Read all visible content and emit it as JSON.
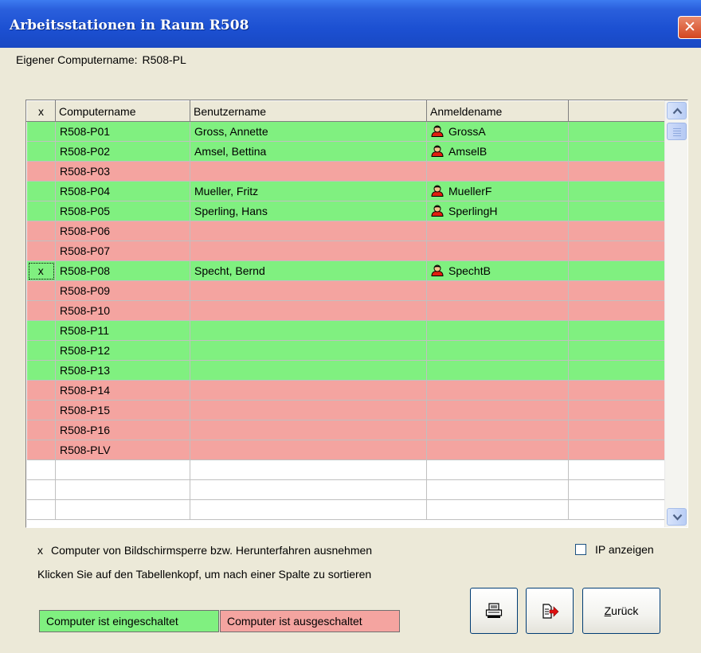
{
  "window": {
    "title": "Arbeitsstationen in Raum R508",
    "close_glyph": "✕"
  },
  "own_computer": {
    "label": "Eigener Computername:",
    "value": "R508-PL"
  },
  "table": {
    "columns": [
      "x",
      "Computername",
      "Benutzername",
      "Anmeldename",
      ""
    ],
    "rows": [
      {
        "x": "",
        "computer": "R508-P01",
        "user": "Gross, Annette",
        "login": "GrossA",
        "status": "on"
      },
      {
        "x": "",
        "computer": "R508-P02",
        "user": "Amsel, Bettina",
        "login": "AmselB",
        "status": "on"
      },
      {
        "x": "",
        "computer": "R508-P03",
        "user": "",
        "login": "",
        "status": "off"
      },
      {
        "x": "",
        "computer": "R508-P04",
        "user": "Mueller, Fritz",
        "login": "MuellerF",
        "status": "on"
      },
      {
        "x": "",
        "computer": "R508-P05",
        "user": "Sperling, Hans",
        "login": "SperlingH",
        "status": "on"
      },
      {
        "x": "",
        "computer": "R508-P06",
        "user": "",
        "login": "",
        "status": "off"
      },
      {
        "x": "",
        "computer": "R508-P07",
        "user": "",
        "login": "",
        "status": "off"
      },
      {
        "x": "x",
        "computer": "R508-P08",
        "user": "Specht, Bernd",
        "login": "SpechtB",
        "status": "on"
      },
      {
        "x": "",
        "computer": "R508-P09",
        "user": "",
        "login": "",
        "status": "off"
      },
      {
        "x": "",
        "computer": "R508-P10",
        "user": "",
        "login": "",
        "status": "off"
      },
      {
        "x": "",
        "computer": "R508-P11",
        "user": "",
        "login": "",
        "status": "on"
      },
      {
        "x": "",
        "computer": "R508-P12",
        "user": "",
        "login": "",
        "status": "on"
      },
      {
        "x": "",
        "computer": "R508-P13",
        "user": "",
        "login": "",
        "status": "on"
      },
      {
        "x": "",
        "computer": "R508-P14",
        "user": "",
        "login": "",
        "status": "off"
      },
      {
        "x": "",
        "computer": "R508-P15",
        "user": "",
        "login": "",
        "status": "off"
      },
      {
        "x": "",
        "computer": "R508-P16",
        "user": "",
        "login": "",
        "status": "off"
      },
      {
        "x": "",
        "computer": "R508-PLV",
        "user": "",
        "login": "",
        "status": "off"
      }
    ],
    "status_colors": {
      "on": "#80f080",
      "off": "#f4a4a0"
    },
    "login_icon": "user-icon"
  },
  "legend": {
    "x_key": "x",
    "x_text": "Computer von Bildschirmsperre bzw. Herunterfahren ausnehmen",
    "sort_hint": "Klicken Sie auf den Tabellenkopf, um nach einer Spalte zu sortieren",
    "on_text": "Computer ist eingeschaltet",
    "off_text": "Computer ist ausgeschaltet"
  },
  "ip_checkbox": {
    "label": "IP anzeigen",
    "checked": false
  },
  "buttons": {
    "print_icon": "printer-icon",
    "exit_icon": "exit-icon",
    "back_label_mnemonic": "Z",
    "back_label_rest": "urück"
  }
}
